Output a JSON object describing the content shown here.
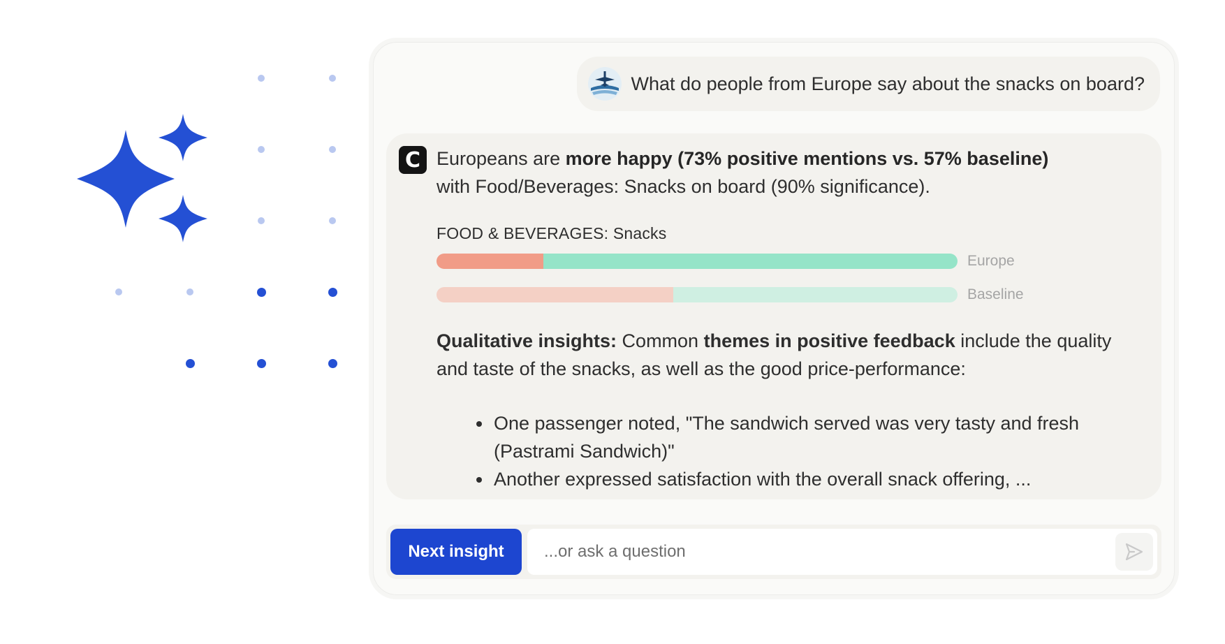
{
  "colors": {
    "accent": "#1d46d0",
    "sparkle": "#2450d4",
    "dot_light": "#b9c8f0",
    "dot_dark": "#2450d4",
    "negative": "#f19c87",
    "positive": "#95e4c8",
    "negative_light": "#f4d0c5",
    "positive_light": "#cfefe2"
  },
  "decor": {
    "sparkles_icon": "sparkles-icon"
  },
  "chat": {
    "user_message": {
      "avatar_icon": "airline-logo-icon",
      "text": "What do people from Europe say about the snacks on board?"
    },
    "answer": {
      "logo_letter": "C",
      "summary": {
        "prefix": "Europeans are ",
        "bold": "more happy (73% positive mentions vs. 57% baseline)",
        "suffix": "with Food/Beverages: Snacks on board (90% significance)."
      },
      "chart": {
        "title": "FOOD & BEVERAGES: Snacks",
        "rows": [
          {
            "label": "Europe",
            "negative_share": 0.205,
            "style": "strong"
          },
          {
            "label": "Baseline",
            "negative_share": 0.455,
            "style": "light"
          }
        ]
      },
      "insights": {
        "label": "Qualitative insights:",
        "text1": " Common ",
        "bold": "themes in positive feedback",
        "text2": " include the quality and taste of the snacks, as well as the good price-performance:"
      },
      "quotes": [
        "One passenger noted, \"The sandwich served was very tasty and fresh (Pastrami Sandwich)\"",
        "Another expressed satisfaction with the overall snack offering, ..."
      ]
    },
    "input": {
      "next_button_label": "Next insight",
      "placeholder": "...or ask a question",
      "send_icon": "send-icon"
    }
  }
}
